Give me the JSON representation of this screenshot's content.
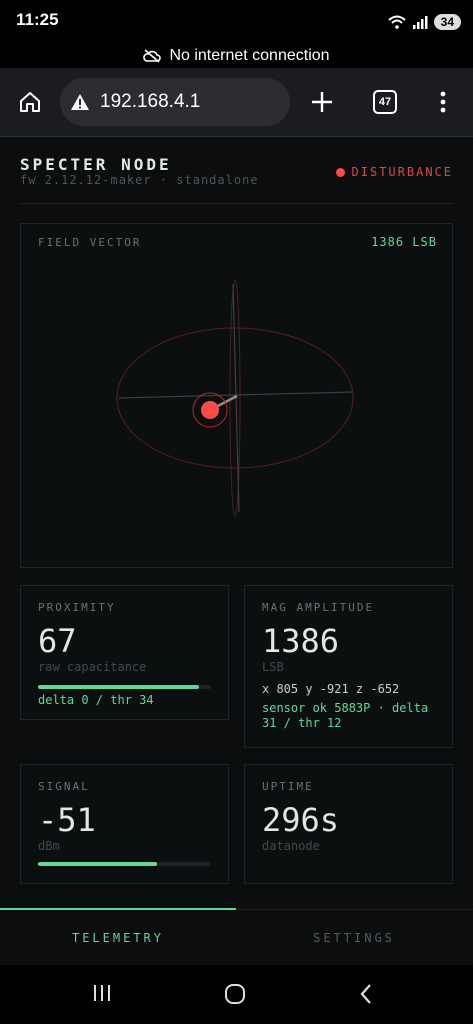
{
  "status_bar": {
    "time": "11:25",
    "battery": "34",
    "icons": [
      "wifi-icon",
      "signal-icon",
      "battery-icon"
    ]
  },
  "offline_banner": {
    "text": "No internet connection",
    "icon": "cloud-off-icon"
  },
  "browser": {
    "url": "192.168.4.1",
    "tab_count": "47",
    "icons": [
      "home-icon",
      "warning-icon",
      "plus-icon",
      "tabs-icon",
      "more-vert-icon"
    ]
  },
  "node": {
    "title": "SPECTER NODE",
    "subtitle": "fw 2.12.12-maker · standalone",
    "status": "DISTURBANCE",
    "status_color": "#ff4a4a"
  },
  "field_vector": {
    "label": "FIELD VECTOR",
    "readout": "1386 LSB"
  },
  "proximity": {
    "label": "PROXIMITY",
    "value": "67",
    "unit": "raw capacitance",
    "bar_fraction": 0.93,
    "detail": "delta 0 / thr 34"
  },
  "mag": {
    "label": "MAG AMPLITUDE",
    "value": "1386",
    "unit": "LSB",
    "xyz": "x 805 y -921 z -652",
    "detail": "sensor ok 5883P · delta 31 / thr 12"
  },
  "signal": {
    "label": "SIGNAL",
    "value": "-51",
    "unit": "dBm",
    "bar_fraction": 0.69
  },
  "uptime": {
    "label": "UPTIME",
    "value": "296s",
    "unit": "datanode"
  },
  "tabs": [
    {
      "label": "TELEMETRY",
      "active": true
    },
    {
      "label": "SETTINGS",
      "active": false
    }
  ],
  "colors": {
    "accent": "#5ed996",
    "alert": "#ff4a4a",
    "background": "#0b0d0e"
  },
  "nav": [
    "recent-apps-icon",
    "home-circle-icon",
    "back-icon"
  ]
}
